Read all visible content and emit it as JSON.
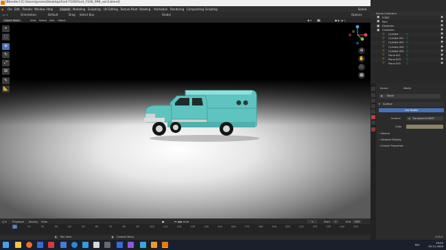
{
  "window": {
    "title": "[Blender] [C:\\Users\\promo\\Desktop\\Ford F100\\Ford_F100_999_ver3.blend]",
    "controls": [
      "—",
      "□",
      "✕"
    ]
  },
  "menubar": {
    "menus": [
      "File",
      "Edit",
      "Render",
      "Window",
      "Help"
    ],
    "workspaces": [
      "Layout",
      "Modeling",
      "Sculpting",
      "UV Editing",
      "Texture Paint",
      "Shading",
      "Animation",
      "Rendering",
      "Compositing",
      "Scripting"
    ],
    "active_workspace": "Layout",
    "scene_label": "Scene",
    "view_layer_label": "View Layer"
  },
  "tool_header": {
    "orientation_label": "Orientation:",
    "orientation_value": "Default",
    "drag_label": "Drag",
    "drag_value": "Select Box",
    "transform_space": "Global",
    "options_label": "Options"
  },
  "viewport_header": {
    "mode": "Object Mode",
    "menus": [
      "View",
      "Select",
      "Add",
      "Object"
    ]
  },
  "toolbar": {
    "tools": [
      "cursor-icon",
      "select-icon",
      "move-icon",
      "rotate-icon",
      "scale-icon",
      "transform-icon",
      "annotate-icon",
      "measure-icon"
    ],
    "active_index": 2
  },
  "outliner": {
    "header_title": "Scene Collection",
    "rows": [
      {
        "name": "FORD",
        "type": "collection"
      },
      {
        "name": "Kolo",
        "type": "collection"
      },
      {
        "name": "Dostavka",
        "type": "collection"
      },
      {
        "name": "Collection",
        "type": "collection"
      },
      {
        "name": "Cylinder",
        "type": "mesh"
      },
      {
        "name": "Cylinder.001",
        "type": "mesh"
      },
      {
        "name": "Cylinder.002",
        "type": "mesh"
      },
      {
        "name": "Cylinder.003",
        "type": "mesh"
      },
      {
        "name": "Cylinder.004",
        "type": "mesh"
      },
      {
        "name": "Plane.001",
        "type": "mesh"
      },
      {
        "name": "Plane.003",
        "type": "mesh"
      },
      {
        "name": "Plane.005",
        "type": "mesh"
      }
    ]
  },
  "properties": {
    "tabs": [
      "Scene",
      "World"
    ],
    "world_name": "World",
    "surface_section": "Surface",
    "use_nodes_label": "Use Nodes",
    "surface_label": "Surface",
    "surface_value": "Transparent BSDF",
    "color_label": "Color",
    "sections": [
      "Volume",
      "Viewport Display",
      "Custom Properties"
    ]
  },
  "timeline": {
    "menus": [
      "Playback",
      "Keying",
      "View"
    ],
    "current_frame": "1",
    "start_label": "Start",
    "start_value": "1",
    "end_label": "End",
    "end_value": "250",
    "ruler": [
      "0",
      "10",
      "20",
      "30",
      "40",
      "50",
      "60",
      "70",
      "80",
      "90",
      "100",
      "110",
      "120",
      "130",
      "140",
      "150",
      "160",
      "170",
      "180",
      "190",
      "200",
      "210",
      "220",
      "230",
      "240",
      "250"
    ]
  },
  "statusbar": {
    "left": "",
    "pan_view": "Pan View",
    "context_menu": "Context Menu",
    "version": "2.91.0"
  },
  "taskbar": {
    "time": "19:02",
    "date": "20.11.2020",
    "lang": "РУС"
  },
  "colors": {
    "accent": "#4772b3",
    "truck": "#5fc4c0",
    "header": "#303030",
    "panel": "#2b2b2b"
  }
}
